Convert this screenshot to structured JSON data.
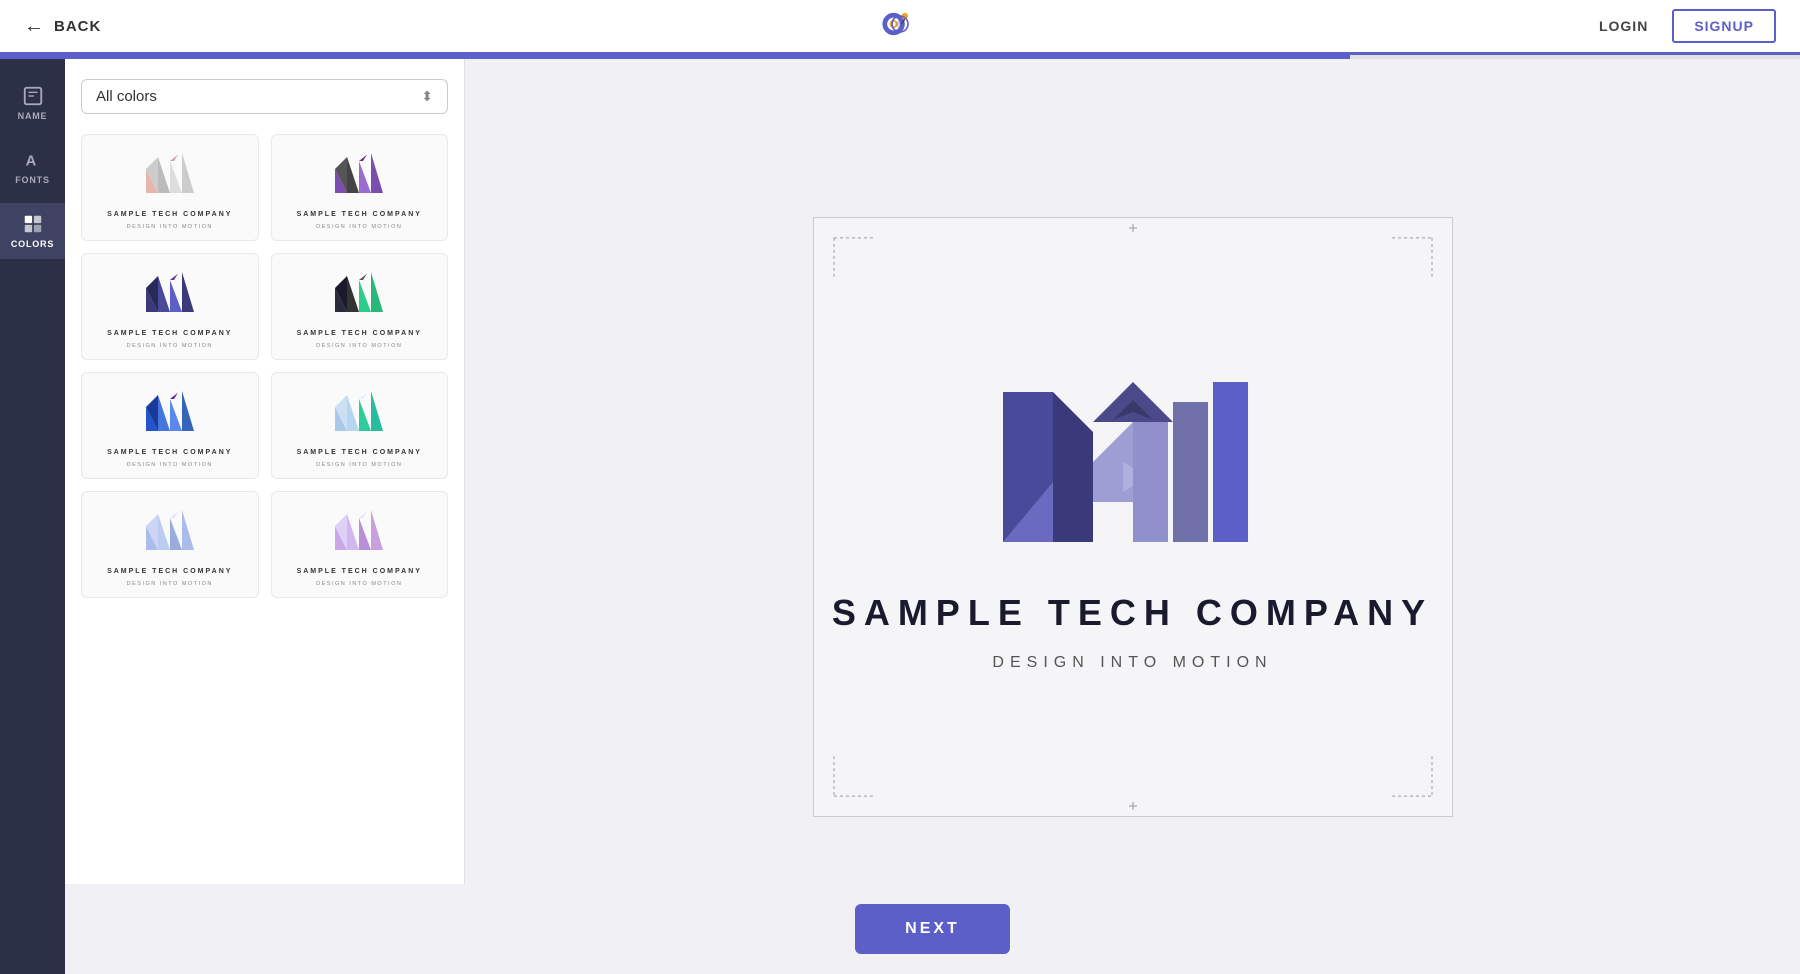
{
  "topnav": {
    "back_label": "BACK",
    "login_label": "LOGIN",
    "signup_label": "SIGNUP"
  },
  "sidebar": {
    "items": [
      {
        "id": "name",
        "label": "NAME",
        "icon": "tag"
      },
      {
        "id": "fonts",
        "label": "FONTS",
        "icon": "font"
      },
      {
        "id": "colors",
        "label": "COLORS",
        "icon": "grid",
        "active": true
      }
    ]
  },
  "left_panel": {
    "filter": {
      "label": "All colors",
      "placeholder": "All colors"
    }
  },
  "preview": {
    "company_name": "SAMPLE TECH COMPANY",
    "tagline": "DESIGN INTO MOTION"
  },
  "bottom": {
    "next_label": "NEXT"
  },
  "colors": {
    "accent": "#5b5fc7",
    "sidebar_bg": "#2c3047"
  }
}
